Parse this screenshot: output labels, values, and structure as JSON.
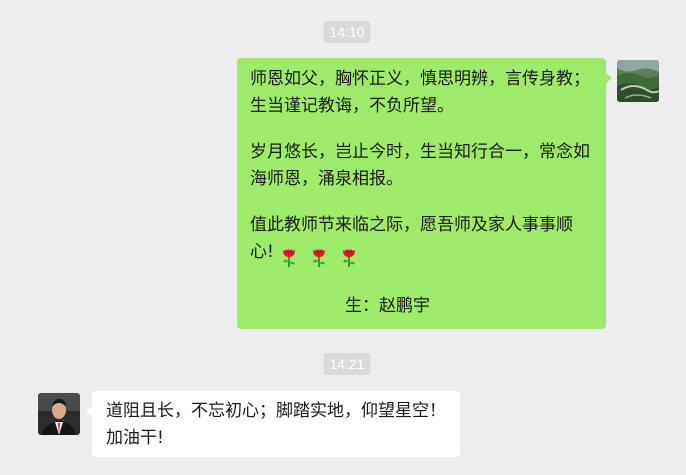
{
  "timestamps": [
    "14:10",
    "14:21"
  ],
  "messages": [
    {
      "side": "outgoing",
      "bubble_color": "#9eea6a",
      "paragraphs": [
        "师恩如父，胸怀正义，慎思明辨，言传身教；生当谨记教诲，不负所望。",
        "岁月悠长，岂止今时，生当知行合一，常念如海师恩，涌泉相报。",
        "值此教师节来临之际，愿吾师及家人事事顺心!"
      ],
      "emoji": [
        "rose-emoji",
        "rose-emoji",
        "rose-emoji"
      ],
      "signature": "生：赵鹏宇"
    },
    {
      "side": "incoming",
      "bubble_color": "#ffffff",
      "text": "道阻且长，不忘初心；脚踏实地，仰望星空！加油干!"
    }
  ],
  "colors": {
    "background": "#ededed",
    "timestamp_bg": "#dadada",
    "outgoing_bubble": "#9eea6a",
    "incoming_bubble": "#ffffff"
  }
}
